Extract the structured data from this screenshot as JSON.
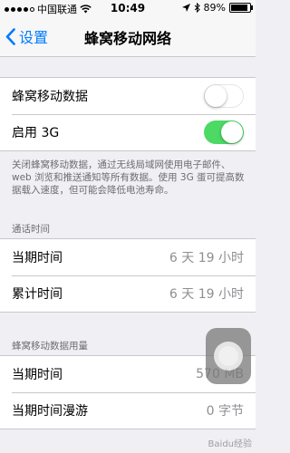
{
  "status_bar": {
    "carrier": "中国联通",
    "time": "10:49",
    "battery_percent": "89%",
    "battery_level": 0.89
  },
  "nav": {
    "back_label": "设置",
    "title": "蜂窝移动网络"
  },
  "toggles": [
    {
      "label": "蜂窝移动数据",
      "state": "off"
    },
    {
      "label": "启用 3G",
      "state": "on"
    }
  ],
  "description": "关闭蜂窝移动数据，通过无线局域网使用电子邮件、web 浏览和推送通知等所有数据。使用 3G 蛋可提高数据载入速度，但可能会降低电池寿命。",
  "call_time": {
    "header": "通话时间",
    "rows": [
      {
        "label": "当期时间",
        "value": "6 天 19 小时"
      },
      {
        "label": "累计时间",
        "value": "6 天 19 小时"
      }
    ]
  },
  "data_usage": {
    "header": "蜂窝移动数据用量",
    "rows": [
      {
        "label": "当期时间",
        "value": "570 MB"
      },
      {
        "label": "当期时间漫游",
        "value": "0 字节"
      }
    ]
  },
  "colors": {
    "accent": "#007aff",
    "switch_on": "#4cd964",
    "background": "#efeff4"
  },
  "watermark": "Baidu经验"
}
